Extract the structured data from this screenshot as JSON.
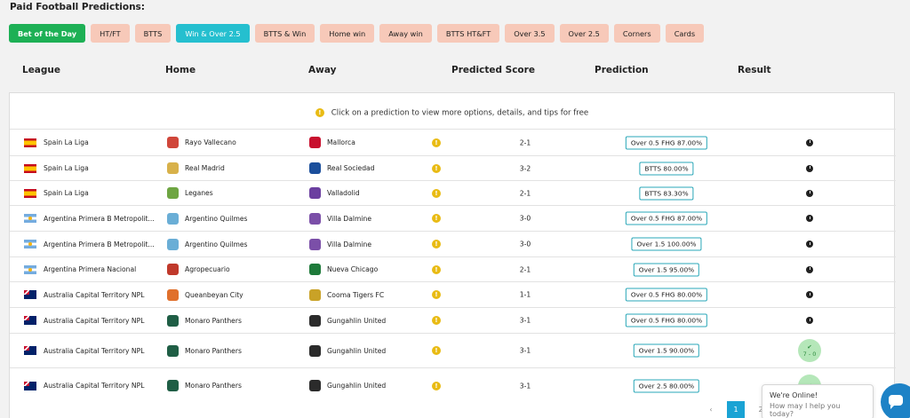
{
  "title": "Paid Football Predictions:",
  "tabs": [
    {
      "label": "Bet of the Day",
      "style": "green"
    },
    {
      "label": "HT/FT",
      "style": "peach"
    },
    {
      "label": "BTTS",
      "style": "peach"
    },
    {
      "label": "Win & Over 2.5",
      "style": "teal"
    },
    {
      "label": "BTTS & Win",
      "style": "peach"
    },
    {
      "label": "Home win",
      "style": "peach"
    },
    {
      "label": "Away win",
      "style": "peach"
    },
    {
      "label": "BTTS HT&FT",
      "style": "peach"
    },
    {
      "label": "Over 3.5",
      "style": "peach"
    },
    {
      "label": "Over 2.5",
      "style": "peach"
    },
    {
      "label": "Corners",
      "style": "peach"
    },
    {
      "label": "Cards",
      "style": "peach"
    }
  ],
  "columns": {
    "league": "League",
    "home": "Home",
    "away": "Away",
    "score": "Predicted Score",
    "prediction": "Prediction",
    "result": "Result"
  },
  "info_text": "Click on a prediction to view more options, details, and tips for free",
  "rows": [
    {
      "flag": "es",
      "league": "Spain La Liga",
      "home": "Rayo Vallecano",
      "home_color": "#d0463a",
      "away": "Mallorca",
      "away_color": "#c8102e",
      "score": "2-1",
      "prediction": "Over 0.5 FHG 87.00%",
      "result": "pending"
    },
    {
      "flag": "es",
      "league": "Spain La Liga",
      "home": "Real Madrid",
      "home_color": "#d8b14a",
      "away": "Real Sociedad",
      "away_color": "#1b4f9c",
      "score": "3-2",
      "prediction": "BTTS 80.00%",
      "result": "pending"
    },
    {
      "flag": "es",
      "league": "Spain La Liga",
      "home": "Leganes",
      "home_color": "#6ea542",
      "away": "Valladolid",
      "away_color": "#6b3fa0",
      "score": "2-1",
      "prediction": "BTTS 83.30%",
      "result": "pending"
    },
    {
      "flag": "ar",
      "league": "Argentina Primera B Metropolit...",
      "home": "Argentino Quilmes",
      "home_color": "#6aaed6",
      "away": "Villa Dalmine",
      "away_color": "#7b4fa8",
      "score": "3-0",
      "prediction": "Over 0.5 FHG 87.00%",
      "result": "pending"
    },
    {
      "flag": "ar",
      "league": "Argentina Primera B Metropolit...",
      "home": "Argentino Quilmes",
      "home_color": "#6aaed6",
      "away": "Villa Dalmine",
      "away_color": "#7b4fa8",
      "score": "3-0",
      "prediction": "Over 1.5 100.00%",
      "result": "pending"
    },
    {
      "flag": "ar",
      "league": "Argentina Primera Nacional",
      "home": "Agropecuario",
      "home_color": "#c0392b",
      "away": "Nueva Chicago",
      "away_color": "#1e7a3a",
      "score": "2-1",
      "prediction": "Over 1.5 95.00%",
      "result": "pending"
    },
    {
      "flag": "au",
      "league": "Australia Capital Territory NPL",
      "home": "Queanbeyan City",
      "home_color": "#e0702c",
      "away": "Cooma Tigers FC",
      "away_color": "#c9a227",
      "score": "1-1",
      "prediction": "Over 0.5 FHG 80.00%",
      "result": "pending"
    },
    {
      "flag": "au",
      "league": "Australia Capital Territory NPL",
      "home": "Monaro Panthers",
      "home_color": "#1f5e45",
      "away": "Gungahlin United",
      "away_color": "#2b2b2b",
      "score": "3-1",
      "prediction": "Over 0.5 FHG 80.00%",
      "result": "pending"
    },
    {
      "flag": "au",
      "league": "Australia Capital Territory NPL",
      "home": "Monaro Panthers",
      "home_color": "#1f5e45",
      "away": "Gungahlin United",
      "away_color": "#2b2b2b",
      "score": "3-1",
      "prediction": "Over 1.5 90.00%",
      "result": "won",
      "result_text": "7 - 0"
    },
    {
      "flag": "au",
      "league": "Australia Capital Territory NPL",
      "home": "Monaro Panthers",
      "home_color": "#1f5e45",
      "away": "Gungahlin United",
      "away_color": "#2b2b2b",
      "score": "3-1",
      "prediction": "Over 2.5 80.00%",
      "result": "won",
      "result_text": ""
    }
  ],
  "pagination": {
    "prev": "‹",
    "pages": [
      "1",
      "2"
    ],
    "active": "1"
  },
  "chat": {
    "line1": "We're Online!",
    "line2": "How may I help you today?"
  },
  "colors": {
    "green": "#1db055",
    "teal": "#25bfcf",
    "peach": "#f7c9b9",
    "accent": "#1aa3d4"
  }
}
